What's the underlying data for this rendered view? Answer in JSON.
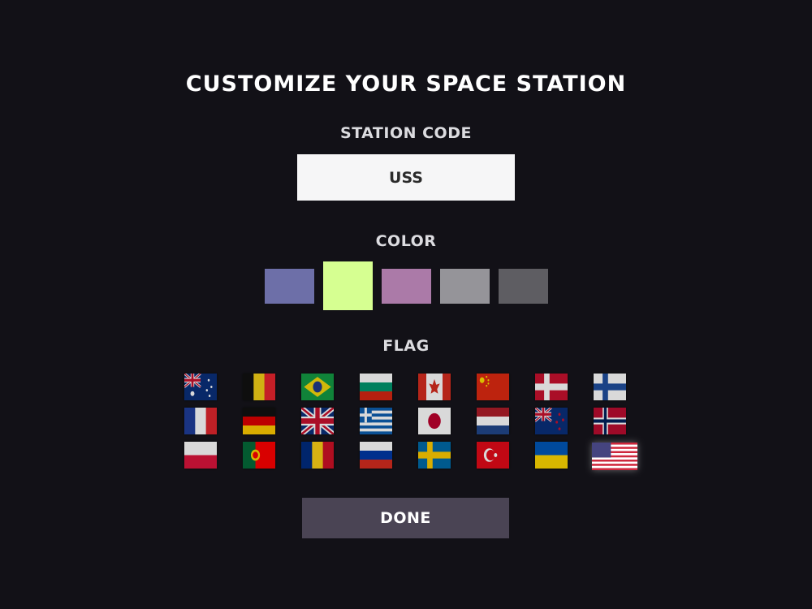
{
  "title": "CUSTOMIZE YOUR SPACE STATION",
  "station_code": {
    "label": "STATION CODE",
    "value": "USS"
  },
  "color": {
    "label": "COLOR",
    "swatches": [
      "#6d6fa8",
      "#d6ff91",
      "#ab7aa8",
      "#959499",
      "#5e5d62"
    ],
    "selected_index": 1
  },
  "flag": {
    "label": "FLAG",
    "rows": [
      [
        "Australia",
        "Belgium",
        "Brazil",
        "Bulgaria",
        "Canada",
        "China",
        "Denmark",
        "Finland"
      ],
      [
        "France",
        "Germany",
        "United Kingdom",
        "Greece",
        "Japan",
        "Netherlands",
        "New Zealand",
        "Norway"
      ],
      [
        "Poland",
        "Portugal",
        "Romania",
        "Russia",
        "Sweden",
        "Turkey",
        "Ukraine",
        "United States"
      ]
    ],
    "selected": "United States"
  },
  "done_label": "DONE"
}
